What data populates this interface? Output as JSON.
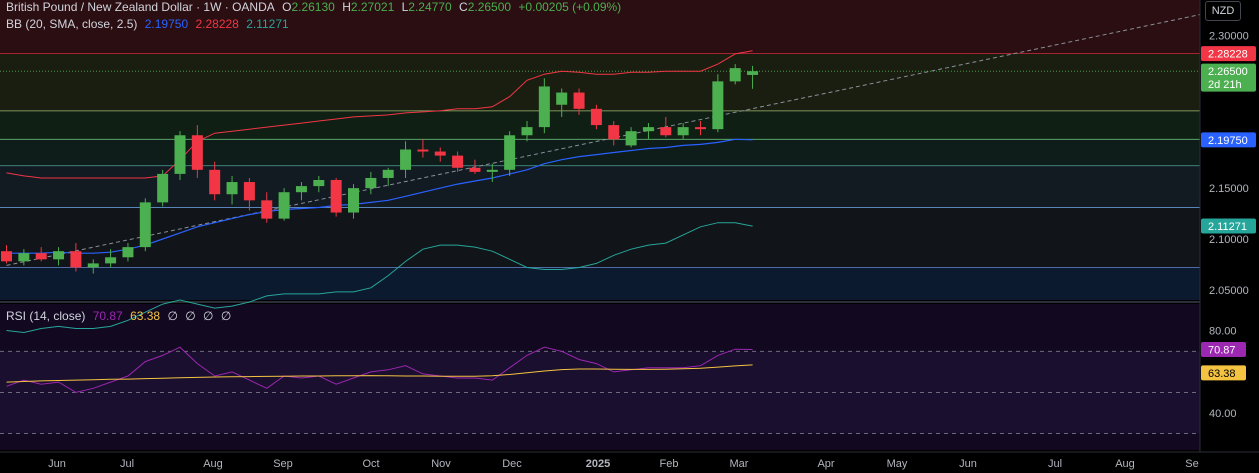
{
  "header": {
    "title": "British Pound / New Zealand Dollar · 1W · OANDA",
    "o_label": "O",
    "o": "2.26130",
    "h_label": "H",
    "h": "2.27021",
    "l_label": "L",
    "l": "2.24770",
    "c_label": "C",
    "c": "2.26500",
    "change": "+0.00205 (+0.09%)",
    "currency": "NZD"
  },
  "bb_header": {
    "label": "BB (20, SMA, close, 2.5)",
    "basis": "2.19750",
    "upper": "2.28228",
    "lower": "2.11271"
  },
  "rsi_header": {
    "label": "RSI (14, close)",
    "rsi": "70.87",
    "ma": "63.38",
    "extra": [
      "∅",
      "∅",
      "∅",
      "∅"
    ]
  },
  "colors": {
    "up": "#4caf50",
    "down": "#f23645",
    "bb_upper": "#f23645",
    "bb_basis": "#2962ff",
    "bb_lower": "#26a69a",
    "rsi": "#9c27b0",
    "rsi_ma": "#f5c342"
  },
  "chart_data": [
    {
      "type": "candlestick",
      "title": "British Pound / New Zealand Dollar · 1W · OANDA",
      "ylim": [
        2.04,
        2.335
      ],
      "y_ticks": [
        2.05,
        2.1,
        2.15,
        2.3
      ],
      "y_tick_labels": [
        "2.05000",
        "2.10000",
        "2.15000",
        "2.30000"
      ],
      "x_ticks": [
        "Jun",
        "Jul",
        "Aug",
        "Sep",
        "Oct",
        "Nov",
        "Dec",
        "2025",
        "Feb",
        "Mar",
        "Apr",
        "May",
        "Jun",
        "Jul",
        "Aug",
        "Se"
      ],
      "price_tags": [
        {
          "label": "2.28228",
          "value": 2.28228,
          "color": "#f23645"
        },
        {
          "label": "2.26500",
          "sub": "2d 21h",
          "value": 2.265,
          "color": "#4caf50"
        },
        {
          "label": "2.19750",
          "value": 2.1975,
          "color": "#2962ff"
        },
        {
          "label": "2.11271",
          "value": 2.11271,
          "color": "#26a69a"
        }
      ],
      "horizontal_levels": [
        2.2823,
        2.226,
        2.198,
        2.172,
        2.131,
        2.072
      ],
      "trendline": {
        "from": [
          0,
          2.074
        ],
        "to": [
          70,
          2.325
        ]
      },
      "ohlc": [
        [
          2.088,
          2.094,
          2.076,
          2.078
        ],
        [
          2.078,
          2.09,
          2.074,
          2.086
        ],
        [
          2.086,
          2.092,
          2.078,
          2.08
        ],
        [
          2.08,
          2.092,
          2.074,
          2.088
        ],
        [
          2.088,
          2.096,
          2.068,
          2.072
        ],
        [
          2.072,
          2.08,
          2.066,
          2.076
        ],
        [
          2.076,
          2.09,
          2.072,
          2.082
        ],
        [
          2.082,
          2.096,
          2.078,
          2.092
        ],
        [
          2.092,
          2.14,
          2.088,
          2.136
        ],
        [
          2.136,
          2.168,
          2.132,
          2.164
        ],
        [
          2.164,
          2.206,
          2.158,
          2.202
        ],
        [
          2.202,
          2.212,
          2.16,
          2.168
        ],
        [
          2.168,
          2.176,
          2.138,
          2.144
        ],
        [
          2.144,
          2.162,
          2.134,
          2.156
        ],
        [
          2.156,
          2.16,
          2.128,
          2.138
        ],
        [
          2.138,
          2.146,
          2.116,
          2.12
        ],
        [
          2.12,
          2.15,
          2.118,
          2.146
        ],
        [
          2.146,
          2.156,
          2.138,
          2.152
        ],
        [
          2.152,
          2.162,
          2.146,
          2.158
        ],
        [
          2.158,
          2.16,
          2.122,
          2.126
        ],
        [
          2.126,
          2.154,
          2.12,
          2.15
        ],
        [
          2.15,
          2.166,
          2.144,
          2.16
        ],
        [
          2.16,
          2.17,
          2.152,
          2.168
        ],
        [
          2.168,
          2.196,
          2.16,
          2.188
        ],
        [
          2.188,
          2.198,
          2.18,
          2.186
        ],
        [
          2.186,
          2.19,
          2.176,
          2.182
        ],
        [
          2.182,
          2.186,
          2.166,
          2.17
        ],
        [
          2.17,
          2.178,
          2.164,
          2.166
        ],
        [
          2.166,
          2.174,
          2.156,
          2.168
        ],
        [
          2.168,
          2.206,
          2.162,
          2.202
        ],
        [
          2.202,
          2.216,
          2.196,
          2.21
        ],
        [
          2.21,
          2.258,
          2.204,
          2.25
        ],
        [
          2.232,
          2.248,
          2.22,
          2.244
        ],
        [
          2.244,
          2.248,
          2.222,
          2.228
        ],
        [
          2.228,
          2.232,
          2.208,
          2.212
        ],
        [
          2.212,
          2.216,
          2.192,
          2.198
        ],
        [
          2.192,
          2.21,
          2.19,
          2.206
        ],
        [
          2.206,
          2.214,
          2.198,
          2.21
        ],
        [
          2.21,
          2.22,
          2.2,
          2.202
        ],
        [
          2.202,
          2.214,
          2.198,
          2.21
        ],
        [
          2.21,
          2.216,
          2.202,
          2.208
        ],
        [
          2.208,
          2.262,
          2.205,
          2.255
        ],
        [
          2.255,
          2.272,
          2.252,
          2.268
        ],
        [
          2.2613,
          2.2702,
          2.2477,
          2.265
        ]
      ],
      "bb_upper": [
        2.165,
        2.162,
        2.16,
        2.16,
        2.16,
        2.16,
        2.16,
        2.16,
        2.16,
        2.162,
        2.178,
        2.196,
        2.204,
        2.206,
        2.208,
        2.21,
        2.212,
        2.214,
        2.216,
        2.218,
        2.22,
        2.221,
        2.222,
        2.224,
        2.225,
        2.226,
        2.228,
        2.228,
        2.23,
        2.24,
        2.256,
        2.262,
        2.265,
        2.264,
        2.262,
        2.262,
        2.264,
        2.264,
        2.265,
        2.265,
        2.265,
        2.272,
        2.282,
        2.285
      ],
      "bb_basis": [
        2.086,
        2.086,
        2.086,
        2.087,
        2.086,
        2.086,
        2.087,
        2.09,
        2.094,
        2.1,
        2.106,
        2.112,
        2.116,
        2.12,
        2.124,
        2.127,
        2.129,
        2.13,
        2.131,
        2.133,
        2.134,
        2.136,
        2.138,
        2.142,
        2.146,
        2.15,
        2.154,
        2.157,
        2.16,
        2.164,
        2.168,
        2.174,
        2.178,
        2.181,
        2.183,
        2.185,
        2.187,
        2.189,
        2.19,
        2.192,
        2.193,
        2.195,
        2.198,
        2.1975
      ],
      "bb_lower": [
        2.01,
        2.008,
        2.012,
        2.014,
        2.012,
        2.012,
        2.014,
        2.02,
        2.028,
        2.036,
        2.04,
        2.036,
        2.032,
        2.034,
        2.038,
        2.044,
        2.046,
        2.046,
        2.046,
        2.048,
        2.048,
        2.052,
        2.064,
        2.078,
        2.09,
        2.094,
        2.094,
        2.092,
        2.088,
        2.08,
        2.072,
        2.07,
        2.07,
        2.072,
        2.076,
        2.084,
        2.09,
        2.094,
        2.096,
        2.104,
        2.112,
        2.116,
        2.116,
        2.1127
      ]
    },
    {
      "type": "line",
      "title": "RSI (14, close)",
      "ylim": [
        22,
        93
      ],
      "y_ticks": [
        40,
        60,
        80
      ],
      "y_tick_labels": [
        "40.00",
        "60.00",
        "80.00"
      ],
      "levels": [
        70,
        50,
        30
      ],
      "tags": [
        {
          "label": "70.87",
          "value": 70.87,
          "color": "#9c27b0"
        },
        {
          "label": "63.38",
          "value": 63.38,
          "color": "#f5c342"
        }
      ],
      "series": [
        {
          "values": [
            53,
            56,
            54,
            55,
            50,
            52,
            55,
            58,
            65,
            68,
            72,
            64,
            58,
            60,
            56,
            52,
            58,
            57,
            58,
            54,
            57,
            60,
            61,
            63,
            59,
            58,
            57,
            57,
            56,
            62,
            68,
            72,
            70,
            66,
            64,
            60,
            61,
            62,
            62,
            62,
            63,
            68,
            71,
            70.87
          ],
          "color": "#9c27b0"
        },
        {
          "values": [
            55,
            55.3,
            55.6,
            55.8,
            56,
            56.2,
            56.4,
            56.5,
            56.7,
            56.9,
            57.1,
            57.3,
            57.5,
            57.6,
            57.7,
            57.8,
            57.9,
            58,
            58,
            58.1,
            58.1,
            58.2,
            58.1,
            58,
            58,
            57.9,
            57.9,
            57.9,
            58.1,
            58.7,
            59.6,
            60.4,
            61.1,
            61.4,
            61.4,
            61.3,
            61.2,
            61.2,
            61.3,
            61.5,
            61.8,
            62.3,
            62.9,
            63.38
          ],
          "color": "#f5c342"
        }
      ]
    }
  ]
}
